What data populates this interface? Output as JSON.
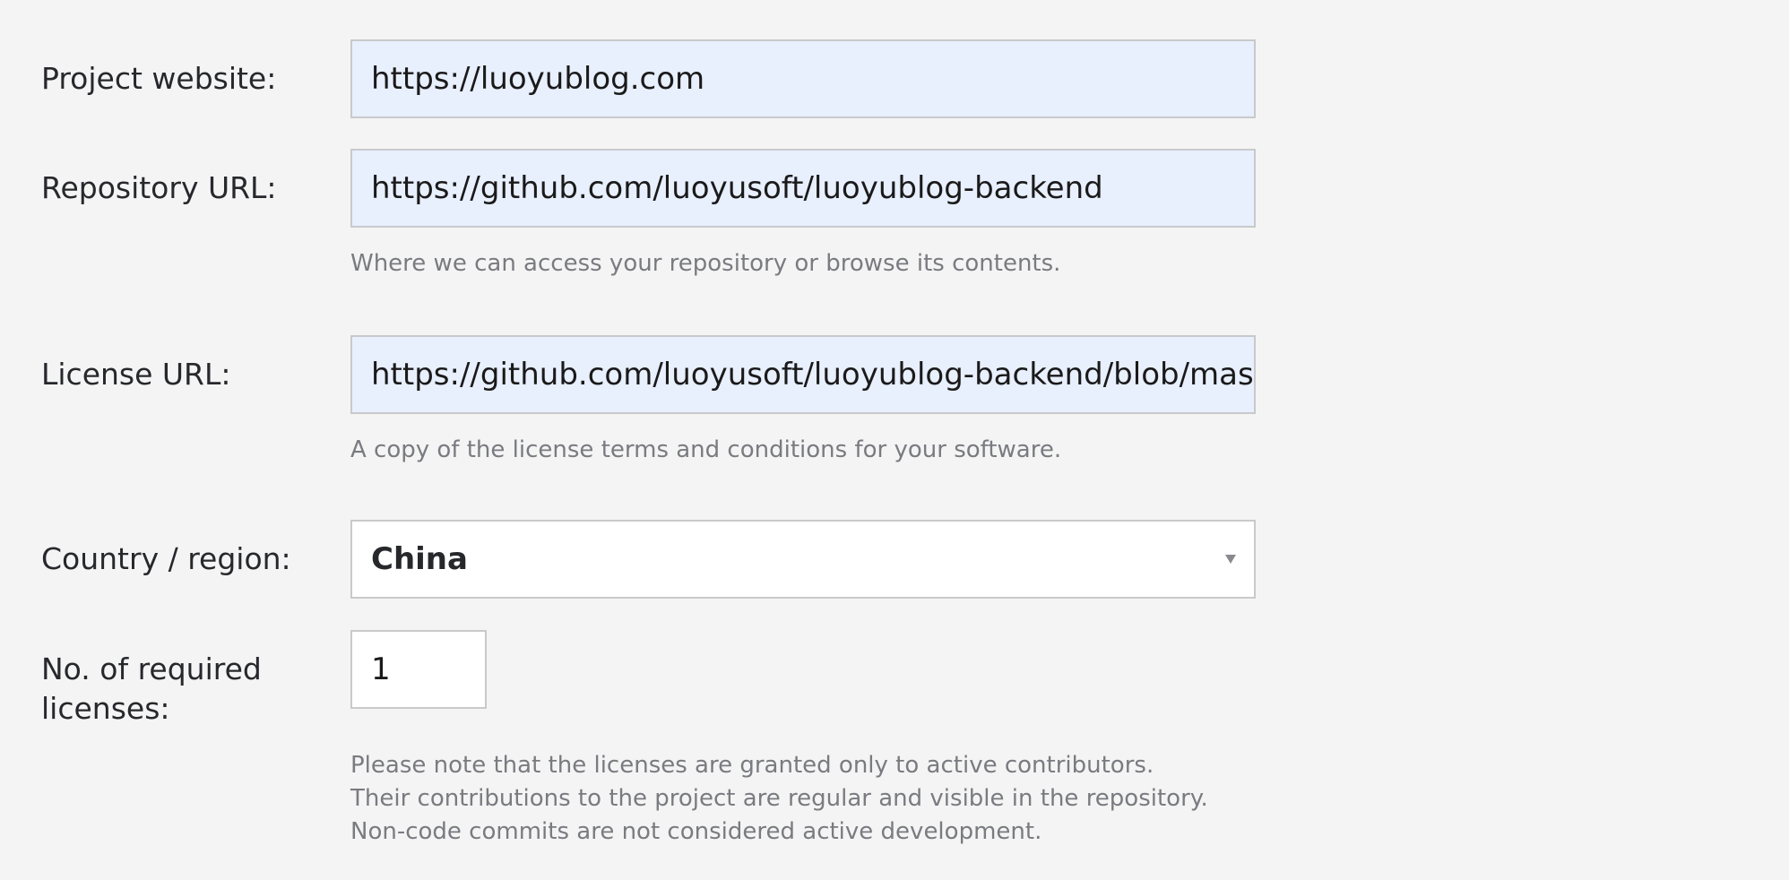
{
  "form": {
    "project_website": {
      "label": "Project website:",
      "value": "https://luoyublog.com"
    },
    "repository_url": {
      "label": "Repository URL:",
      "value": "https://github.com/luoyusoft/luoyublog-backend",
      "hint": "Where we can access your repository or browse its contents."
    },
    "license_url": {
      "label": "License URL:",
      "value": "https://github.com/luoyusoft/luoyublog-backend/blob/master/LI",
      "hint": "A copy of the license terms and conditions for your software."
    },
    "country_region": {
      "label": "Country / region:",
      "selected": "China",
      "icon": "chevron-down-icon"
    },
    "required_licenses": {
      "label_line1": "No. of required",
      "label_line2": "licenses:",
      "value": "1",
      "hint_line1": "Please note that the licenses are granted only to active contributors.",
      "hint_line2": "Their contributions to the project are regular and visible in the repository.",
      "hint_line3": "Non-code commits are not considered active development."
    }
  },
  "colors": {
    "page_background": "#f4f4f4",
    "autofill_background": "#e8effd",
    "field_border": "#c9c9cc",
    "label_text": "#27282c",
    "hint_text": "#7a7b80"
  }
}
